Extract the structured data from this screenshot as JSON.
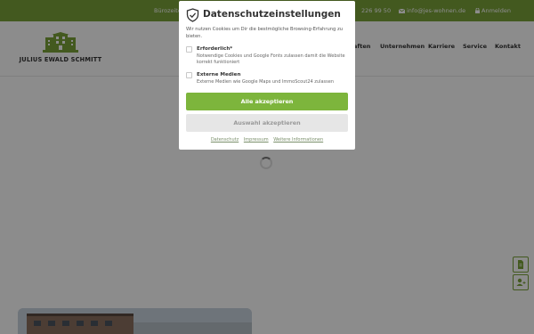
{
  "topbar": {
    "left_text": "Bürozeite",
    "phone": "226 99 50",
    "email": "info@jes-wohnen.de",
    "login": "Anmelden"
  },
  "header": {
    "logo_text": "JULIUS EWALD SCHMITT",
    "nav": [
      "aften",
      "Unternehmen",
      "Karriere",
      "Service",
      "Kontakt"
    ]
  },
  "consent": {
    "title": "Datenschutzeinstellungen",
    "intro": "Wir nutzen Cookies um Dir die bestmögliche Browsing-Erfahrung zu bieten.",
    "options": [
      {
        "title": "Erforderlich*",
        "desc": "Notwendige Cookies und Google Fonts zulassen damit die Website korrekt funktioniert"
      },
      {
        "title": "Externe Medien",
        "desc": "Externe Medien wie Google Maps und ImmoScout24 zulassen"
      }
    ],
    "accept_all": "Alle akzeptieren",
    "accept_selection": "Auswahl akzeptieren",
    "links": [
      "Datenschutz",
      "Impressum",
      "Weitere Informationen"
    ]
  },
  "colors": {
    "brand_green": "#7aa23a",
    "button_green": "#7db53c"
  }
}
